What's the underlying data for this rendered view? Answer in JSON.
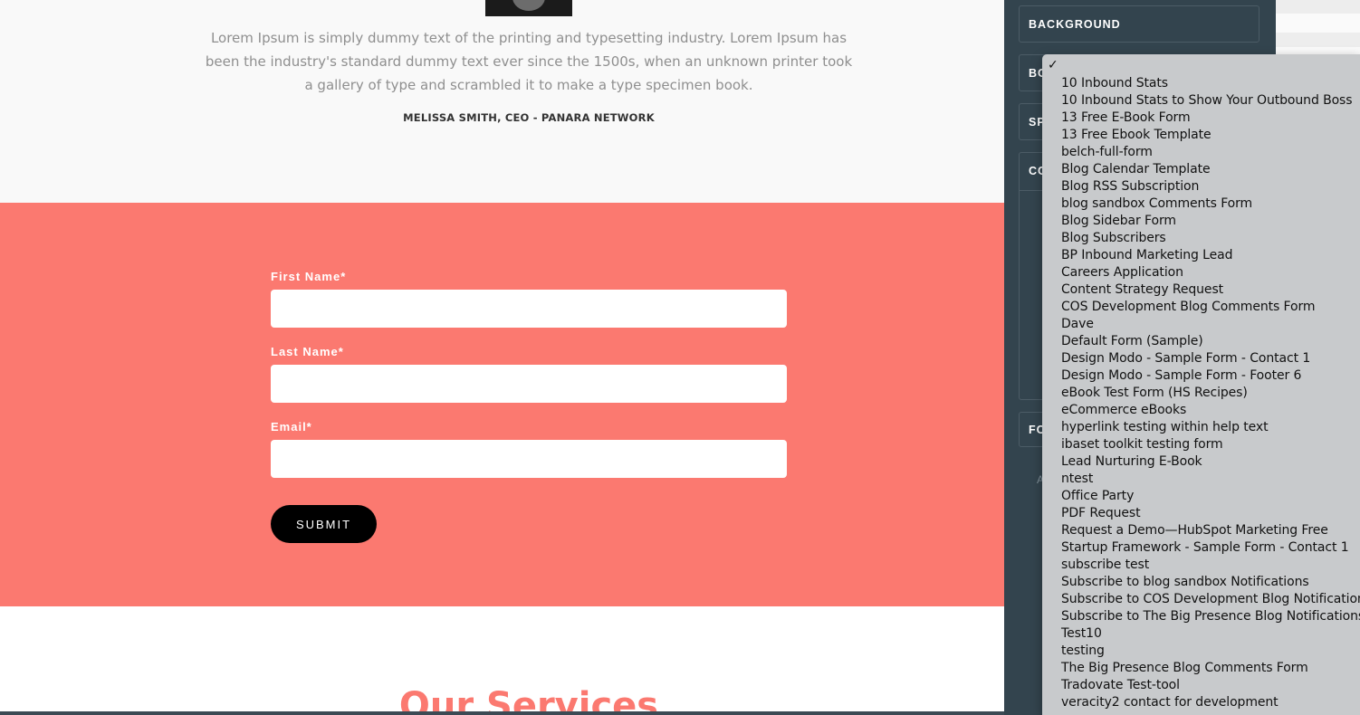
{
  "testimonial": {
    "quote": "Lorem Ipsum is simply dummy text of the printing and typesetting industry. Lorem Ipsum has been the industry's standard dummy text ever since the 1500s, when an unknown printer took a gallery of type and scrambled it to make a type specimen book.",
    "author": "MELISSA SMITH, CEO - PANARA NETWORK"
  },
  "form": {
    "first_name_label": "First Name*",
    "first_name_value": "",
    "last_name_label": "Last Name*",
    "last_name_value": "",
    "email_label": "Email*",
    "email_value": "",
    "submit_label": "SUBMIT"
  },
  "services": {
    "title": "Our Services"
  },
  "panel": {
    "sections": {
      "background": "BACKGROUND",
      "border": "BO",
      "spacing": "SP",
      "content": "CO",
      "font": "FO"
    },
    "hint": "A"
  },
  "dropdown": {
    "selected_marker": "✓",
    "items": [
      "10 Inbound Stats",
      "10 Inbound Stats to Show Your Outbound Boss",
      "13 Free E-Book Form",
      "13 Free Ebook Template",
      "belch-full-form",
      "Blog Calendar Template",
      "Blog RSS Subscription",
      "blog sandbox Comments Form",
      "Blog Sidebar Form",
      "Blog Subscribers",
      "BP Inbound Marketing Lead",
      "Careers Application",
      "Content Strategy Request",
      "COS Development Blog Comments Form",
      "Dave",
      "Default Form (Sample)",
      "Design Modo - Sample Form - Contact 1",
      "Design Modo - Sample Form - Footer 6",
      "eBook Test Form (HS Recipes)",
      "eCommerce eBooks",
      "hyperlink testing within help text",
      "ibaset toolkit testing form",
      "Lead Nurturing E-Book",
      "ntest",
      "Office Party",
      "PDF Request",
      "Request a Demo—HubSpot Marketing Free",
      "Startup Framework - Sample Form - Contact 1",
      "subscribe test",
      "Subscribe to blog sandbox Notifications",
      "Subscribe to COS Development Blog Notifications",
      "Subscribe to The Big Presence Blog Notifications",
      "Test10",
      "testing",
      "The Big Presence Blog Comments Form",
      "Tradovate Test-tool",
      "veracity2 contact for development"
    ]
  }
}
